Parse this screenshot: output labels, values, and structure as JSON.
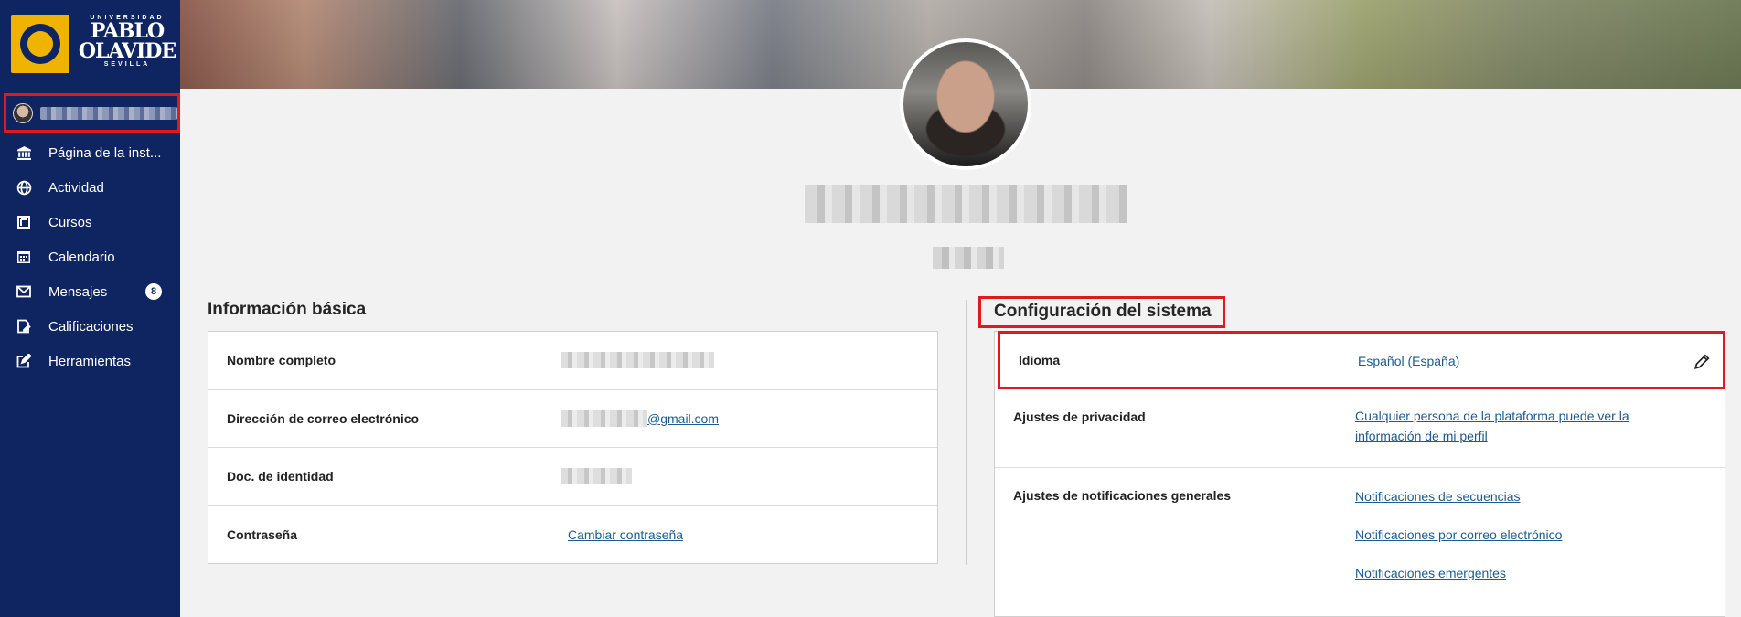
{
  "logo": {
    "university": "UNIVERSIDAD",
    "name_line1": "PABLO",
    "name_de": "DE",
    "name_line2": "OLAVIDE",
    "city": "SEVILLA"
  },
  "sidebar": {
    "items": [
      {
        "label": "Página de la inst...",
        "icon": "institution-icon"
      },
      {
        "label": "Actividad",
        "icon": "globe-icon"
      },
      {
        "label": "Cursos",
        "icon": "courses-icon"
      },
      {
        "label": "Calendario",
        "icon": "calendar-icon"
      },
      {
        "label": "Mensajes",
        "icon": "envelope-icon",
        "badge": "8"
      },
      {
        "label": "Calificaciones",
        "icon": "grades-icon"
      },
      {
        "label": "Herramientas",
        "icon": "tools-icon"
      }
    ]
  },
  "profile": {
    "basic_info_title": "Información básica",
    "system_config_title": "Configuración del sistema",
    "basic_info": {
      "full_name_label": "Nombre completo",
      "email_label": "Dirección de correo electrónico",
      "email_domain": "@gmail.com",
      "id_label": "Doc. de identidad",
      "password_label": "Contraseña",
      "password_link": "Cambiar contraseña"
    },
    "config": {
      "language_label": "Idioma",
      "language_value": "Español (España)",
      "privacy_label": "Ajustes de privacidad",
      "privacy_value": "Cualquier persona de la plataforma puede ver la información de mi perfil",
      "notifications_label": "Ajustes de notificaciones generales",
      "notif_stream": "Notificaciones de secuencias",
      "notif_email": "Notificaciones por correo electrónico",
      "notif_popup": "Notificaciones emergentes"
    }
  },
  "colors": {
    "sidebar_bg": "#0f2561",
    "link": "#1d5b8f",
    "highlight": "#e0191e"
  }
}
